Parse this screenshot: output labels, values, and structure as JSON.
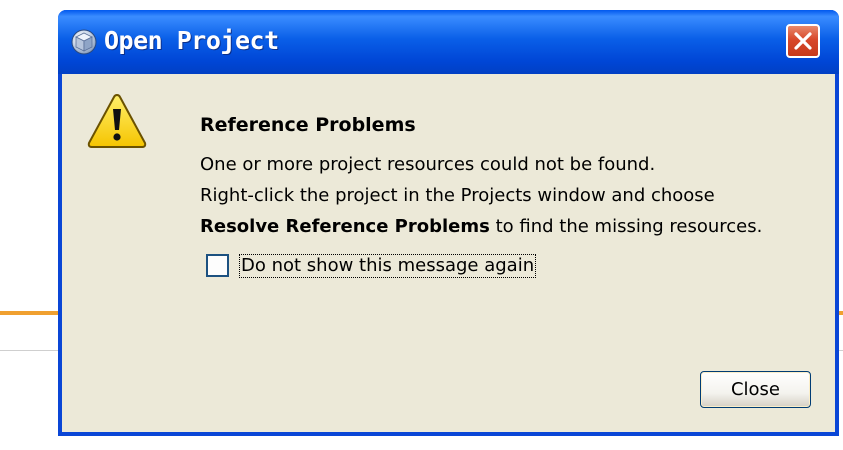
{
  "dialog": {
    "title": "Open Project",
    "title_icon": "project-cube-icon",
    "close_icon": "close-icon"
  },
  "message": {
    "icon": "warning-icon",
    "heading": "Reference Problems",
    "line1": "One or more project resources could not be found.",
    "line2": "Right-click the project in the Projects window and choose",
    "line3_bold": "Resolve Reference Problems",
    "line3_rest": " to find the missing resources."
  },
  "checkbox": {
    "label": "Do not show this message again",
    "checked": false
  },
  "buttons": {
    "close_label": "Close"
  },
  "colors": {
    "titlebar": "#0a5fe8",
    "dialog_bg": "#ece9d8",
    "close_red": "#d8482a",
    "warning_yellow": "#ffd400"
  }
}
